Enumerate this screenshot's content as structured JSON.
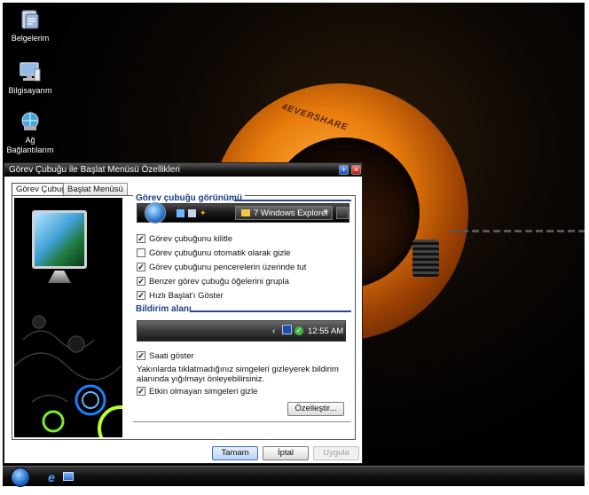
{
  "desktop": {
    "icons": [
      {
        "label": "Belgelerim",
        "icon": "documents-folder-icon"
      },
      {
        "label": "Bilgisayarım",
        "icon": "computer-icon"
      },
      {
        "label": "Ağ Bağlantılarım",
        "icon": "network-connections-icon"
      }
    ],
    "wallpaper_text": "4EVERSHARE",
    "colors": {
      "accent": "#e87d0c",
      "background": "#000000"
    }
  },
  "dialog": {
    "title": "Görev Çubuğu ile Başlat Menüsü Özellikleri",
    "tabs": [
      {
        "label": "Görev Çubuğu",
        "active": true
      },
      {
        "label": "Başlat Menüsü",
        "active": false
      }
    ],
    "taskbar_group": {
      "heading": "Görev çubuğu görünümü",
      "preview_button": "7 Windows Explorer",
      "options": [
        {
          "label": "Görev çubuğunu kilitle",
          "checked": true
        },
        {
          "label": "Görev çubuğunu otomatik olarak gizle",
          "checked": false
        },
        {
          "label": "Görev çubuğunu pencerelerin üzerinde tut",
          "checked": true
        },
        {
          "label": "Benzer görev çubuğu öğelerini grupla",
          "checked": true
        },
        {
          "label": "Hızlı Başlat'ı Göster",
          "checked": true
        }
      ]
    },
    "notification_group": {
      "heading": "Bildirim alanı",
      "tray_time": "12:55 AM",
      "options": [
        {
          "label": "Saati göster",
          "checked": true
        }
      ],
      "description": "Yakınlarda tıklatmadığınız simgeleri gizleyerek bildirim alanında yığılmayı önleyebilirsiniz.",
      "hide_inactive": {
        "label": "Etkin olmayan simgeleri gizle",
        "checked": true
      },
      "customize_button": "Özelleştir..."
    },
    "buttons": {
      "ok": "Tamam",
      "cancel": "İptal",
      "apply": "Uygula",
      "apply_enabled": false
    }
  },
  "taskbar": {
    "start_icon": "start-orb-icon",
    "quick_launch": [
      "internet-explorer-icon",
      "show-desktop-icon"
    ]
  }
}
